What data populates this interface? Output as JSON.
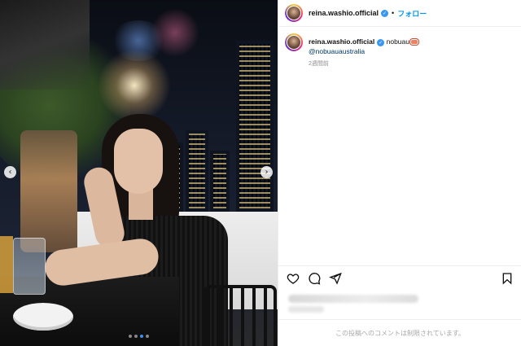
{
  "post": {
    "carousel": {
      "prev_icon": "chevron-left-icon",
      "next_icon": "chevron-right-icon",
      "prev_glyph": "‹",
      "next_glyph": "›",
      "slide_count": 4,
      "active_slide": 3
    },
    "photo_description_alt": "Woman in black dress on a rooftop terrace at night with city skyline"
  },
  "header": {
    "username": "reina.washio.official",
    "separator": "•",
    "follow_label": "フォロー"
  },
  "caption": {
    "username": "reina.washio.official",
    "text": "nobuau",
    "emoji_icon": "sushi-icon",
    "mention": "@nobuauaustralia",
    "time": "2週間前"
  },
  "actions": {
    "like_icon": "heart-icon",
    "comment_icon": "comment-icon",
    "share_icon": "send-icon",
    "save_icon": "bookmark-icon"
  },
  "footer": {
    "comments_disabled": "この投稿へのコメントは制限されています。"
  },
  "colors": {
    "accent": "#0095f6",
    "verified": "#3897f0",
    "mention": "#00376b",
    "carousel_active_dot": "#3b91f3"
  }
}
